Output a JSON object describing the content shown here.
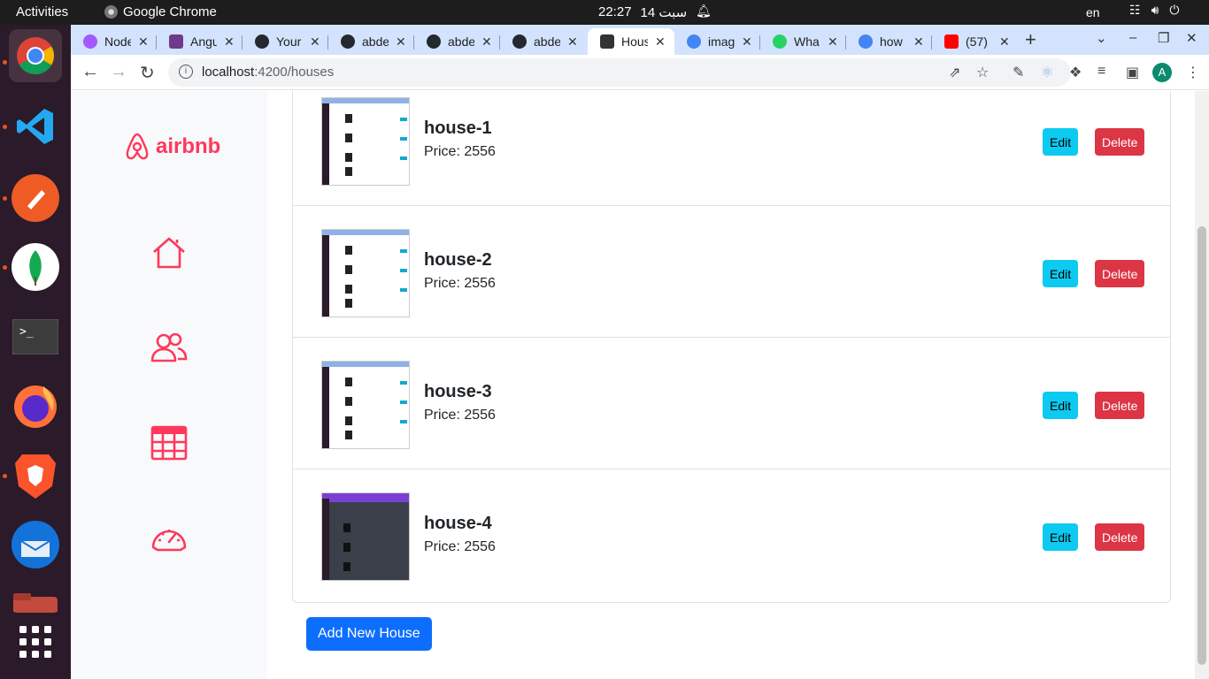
{
  "topbar": {
    "activities": "Activities",
    "app_name": "Google Chrome",
    "time": "22:27",
    "date": "14 سبت",
    "language": "en"
  },
  "dock": {
    "apps": [
      "chrome-icon",
      "vscode-icon",
      "postman-icon",
      "mongodb-compass-icon",
      "terminal-icon",
      "firefox-icon",
      "brave-icon",
      "thunderbird-icon",
      "files-icon",
      "show-apps-icon"
    ]
  },
  "tabs": [
    {
      "title": "Node",
      "favicon": "#a259ff"
    },
    {
      "title": "Angu",
      "favicon": "#6e3b8a"
    },
    {
      "title": "Your",
      "favicon": "#24292f"
    },
    {
      "title": "abde",
      "favicon": "#24292f"
    },
    {
      "title": "abde",
      "favicon": "#24292f"
    },
    {
      "title": "abde",
      "favicon": "#24292f"
    },
    {
      "title": "Hous",
      "favicon": "#333333"
    },
    {
      "title": "imag",
      "favicon": "#4285f4"
    },
    {
      "title": "Wha",
      "favicon": "#25d366"
    },
    {
      "title": "how",
      "favicon": "#4285f4"
    },
    {
      "title": "(57)",
      "favicon": "#ff0000"
    }
  ],
  "toolbar": {
    "url_host": "localhost",
    "url_path": ":4200/houses",
    "avatar_letter": "A"
  },
  "sidebar": {
    "brand": "airbnb",
    "accent": "#ff385c",
    "icons": [
      "home-icon",
      "users-icon",
      "table-icon",
      "dashboard-icon"
    ]
  },
  "houses": [
    {
      "name": "house-1",
      "price": "Price: 2556",
      "edit": "Edit",
      "delete": "Delete"
    },
    {
      "name": "house-2",
      "price": "Price: 2556",
      "edit": "Edit",
      "delete": "Delete"
    },
    {
      "name": "house-3",
      "price": "Price: 2556",
      "edit": "Edit",
      "delete": "Delete"
    },
    {
      "name": "house-4",
      "price": "Price: 2556",
      "edit": "Edit",
      "delete": "Delete"
    }
  ],
  "add_button": "Add New House"
}
